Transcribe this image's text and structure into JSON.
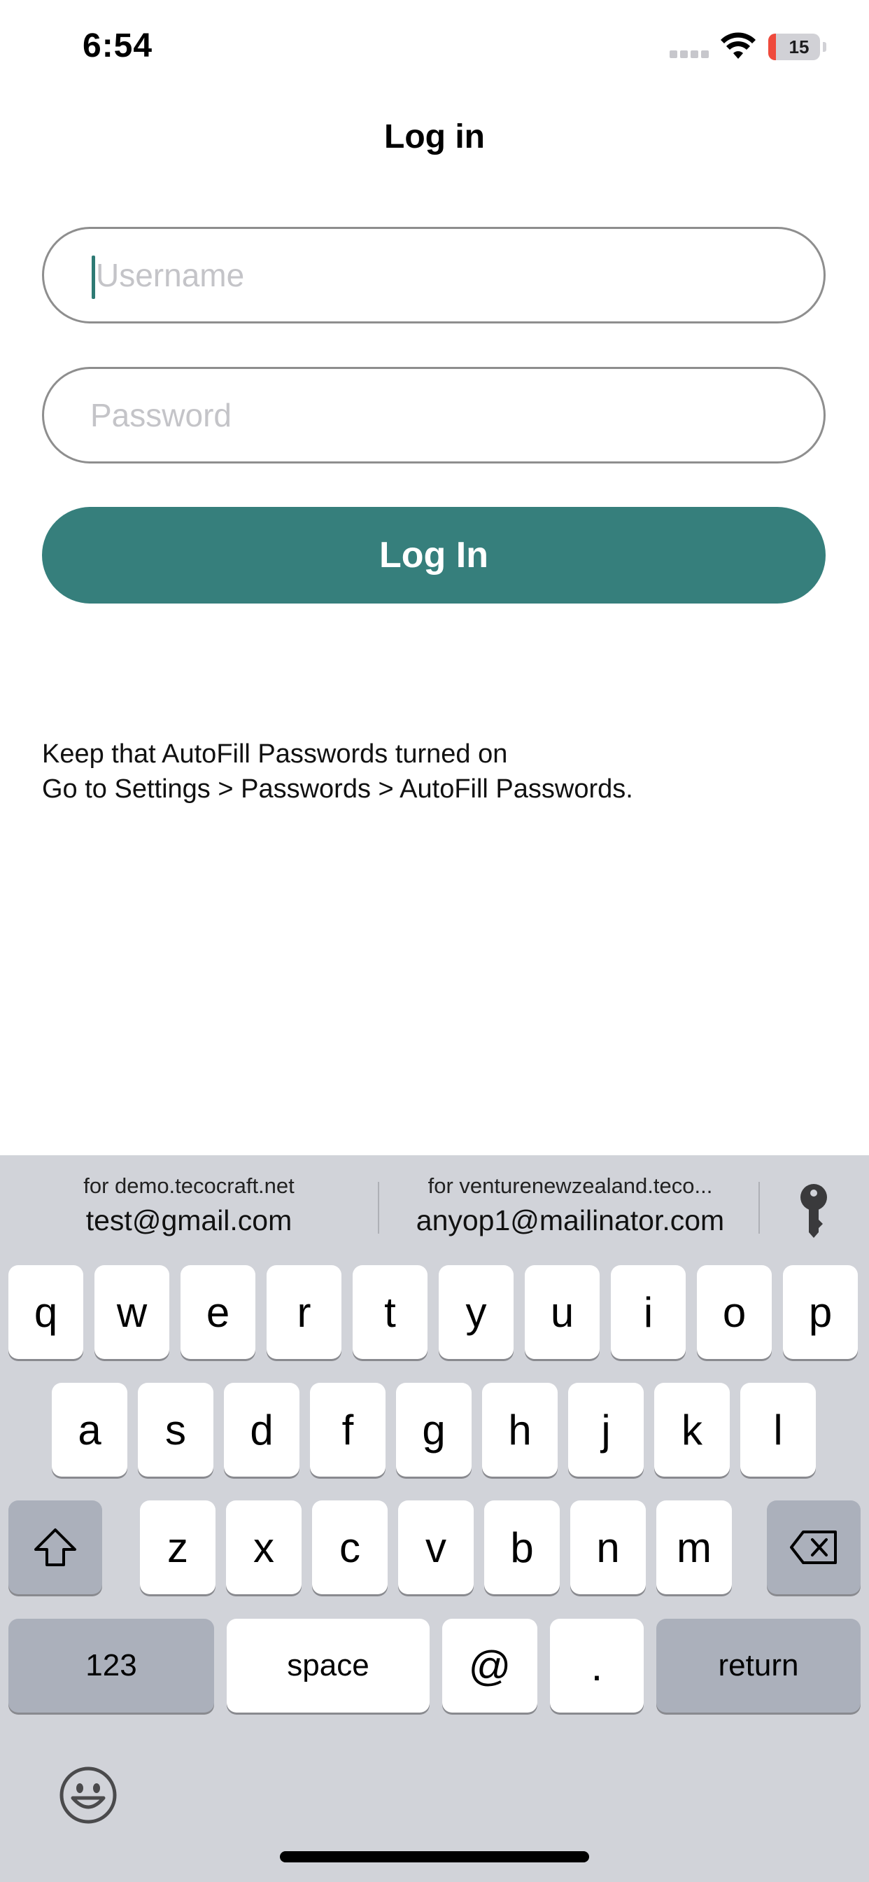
{
  "status_bar": {
    "time": "6:54",
    "battery": "15",
    "battery_level_fraction": 0.15
  },
  "page": {
    "title": "Log in"
  },
  "form": {
    "username_placeholder": "Username",
    "password_placeholder": "Password",
    "login_button": "Log In"
  },
  "hint": {
    "line1": "Keep that AutoFill Passwords turned on",
    "line2": "Go to Settings > Passwords > AutoFill Passwords."
  },
  "autofill_suggestions": [
    {
      "site": "for demo.tecocraft.net",
      "email": "test@gmail.com"
    },
    {
      "site": "for venturenewzealand.teco...",
      "email": "anyop1@mailinator.com"
    }
  ],
  "keyboard": {
    "row1": [
      "q",
      "w",
      "e",
      "r",
      "t",
      "y",
      "u",
      "i",
      "o",
      "p"
    ],
    "row2": [
      "a",
      "s",
      "d",
      "f",
      "g",
      "h",
      "j",
      "k",
      "l"
    ],
    "row3": [
      "z",
      "x",
      "c",
      "v",
      "b",
      "n",
      "m"
    ],
    "numbers_key": "123",
    "space_key": "space",
    "at_key": "@",
    "dot_key": ".",
    "return_key": "return"
  },
  "colors": {
    "accent": "#367f7c",
    "keyboard_bg": "#d1d3d9",
    "battery_low": "#ef4a3c"
  },
  "icons": [
    "wifi-icon",
    "key-icon",
    "shift-icon",
    "backspace-icon",
    "emoji-icon"
  ]
}
